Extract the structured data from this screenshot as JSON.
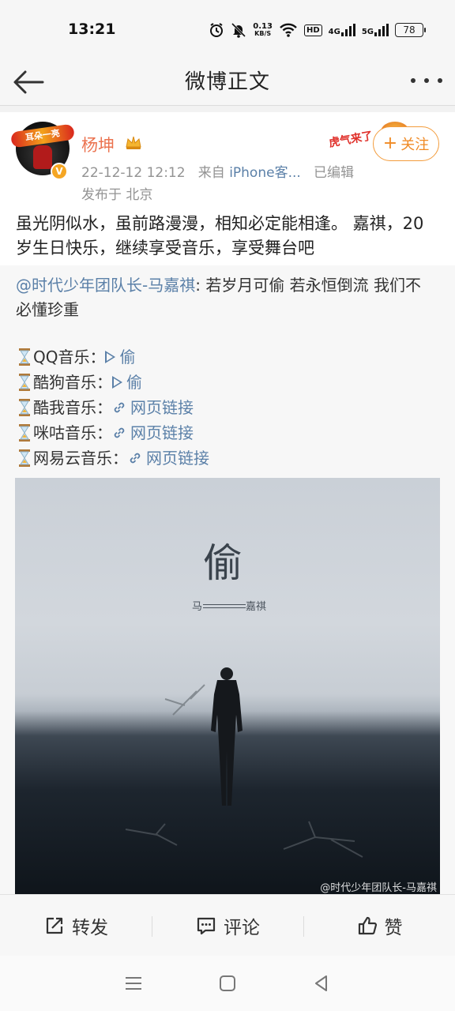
{
  "status_bar": {
    "time": "13:21",
    "net_speed_value": "0.13",
    "net_speed_unit": "KB/S",
    "hd_label": "HD",
    "net1": "4G",
    "net2": "5G",
    "battery": "78",
    "icons": [
      "alarm-icon",
      "mute-icon",
      "wifi-icon",
      "signal-icon",
      "battery-icon"
    ]
  },
  "nav": {
    "title": "微博正文"
  },
  "post": {
    "user_name": "杨坤",
    "avatar_deco_text": "耳朵一亮",
    "verified_badge": "V",
    "time": "22-12-12 12:12",
    "source_prefix": "来自",
    "source": "iPhone客...",
    "edited": "已编辑",
    "location": "发布于 北京",
    "sticker_text": "虎气来了",
    "follow_label": "关注",
    "follow_plus": "+",
    "text": "虽光阴似水，虽前路漫漫，相知必定能相逢。 嘉祺，20岁生日快乐，继续享受音乐，享受舞台吧"
  },
  "repost": {
    "mention": "@时代少年团队长-马嘉祺",
    "text": ": 若岁月可偷 若永恒倒流 我们不必懂珍重",
    "links": [
      {
        "label": "QQ音乐：",
        "value": "偷",
        "icon": "play-icon"
      },
      {
        "label": "酷狗音乐：",
        "value": "偷",
        "icon": "play-icon"
      },
      {
        "label": "酷我音乐：",
        "value": "网页链接",
        "icon": "link-icon"
      },
      {
        "label": "咪咕音乐：",
        "value": "网页链接",
        "icon": "link-icon"
      },
      {
        "label": "网易云音乐：",
        "value": "网页链接",
        "icon": "link-icon"
      }
    ],
    "cover": {
      "title_char": "偷",
      "artist_left": "马",
      "artist_right": "嘉祺",
      "watermark": "@时代少年团队长-马嘉祺"
    }
  },
  "actions": {
    "repost": "转发",
    "comment": "评论",
    "like": "赞"
  },
  "colors": {
    "accent_orange": "#f08a24",
    "username": "#eb7350",
    "link_blue": "#5b80a8"
  }
}
